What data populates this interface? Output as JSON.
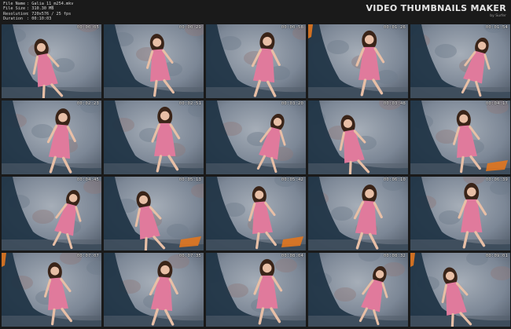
{
  "header": {
    "meta": [
      {
        "key": "File Name",
        "value": ": Galia 11_m254.mkv"
      },
      {
        "key": "File Size",
        "value": ": 310.30 MB"
      },
      {
        "key": "Resolution",
        "value": ": 720x576 / 25 fps"
      },
      {
        "key": "Duration",
        "value": ": 00:10:03"
      }
    ],
    "brand_title": "VIDEO THUMBNAILS MAKER",
    "brand_sub": "by Surfer"
  },
  "thumbnails": [
    {
      "timestamp": "00:00:05",
      "pose": "sitting-floor"
    },
    {
      "timestamp": "00:00:29",
      "pose": "kneeling-arm-up"
    },
    {
      "timestamp": "00:00:58",
      "pose": "leaning-forward"
    },
    {
      "timestamp": "00:01:26",
      "pose": "kneeling-arms-out"
    },
    {
      "timestamp": "00:01:54",
      "pose": "kneeling-front"
    },
    {
      "timestamp": "00:02:23",
      "pose": "lying-side"
    },
    {
      "timestamp": "00:02:51",
      "pose": "sitting-knee"
    },
    {
      "timestamp": "00:03:20",
      "pose": "split-lean"
    },
    {
      "timestamp": "00:03:48",
      "pose": "backbend"
    },
    {
      "timestamp": "00:04:17",
      "pose": "crawling"
    },
    {
      "timestamp": "00:04:45",
      "pose": "sitting-kneeling"
    },
    {
      "timestamp": "00:05:13",
      "pose": "sitting-stretch"
    },
    {
      "timestamp": "00:05:42",
      "pose": "crouching"
    },
    {
      "timestamp": "00:06:10",
      "pose": "standing-side"
    },
    {
      "timestamp": "00:06:39",
      "pose": "lying-pose"
    },
    {
      "timestamp": "00:07:07",
      "pose": "standing-hair"
    },
    {
      "timestamp": "00:07:35",
      "pose": "crouching-low"
    },
    {
      "timestamp": "00:08:04",
      "pose": "standing-front"
    },
    {
      "timestamp": "00:08:32",
      "pose": "squatting"
    },
    {
      "timestamp": "00:09:01",
      "pose": "standing-arm-up"
    }
  ],
  "colors": {
    "background": "#1a1a1a",
    "backdrop": "#7c8796",
    "dress": "#e07a9c",
    "cloth": "#1e3344",
    "skin": "#e8bfa6",
    "hair": "#3a2418"
  }
}
